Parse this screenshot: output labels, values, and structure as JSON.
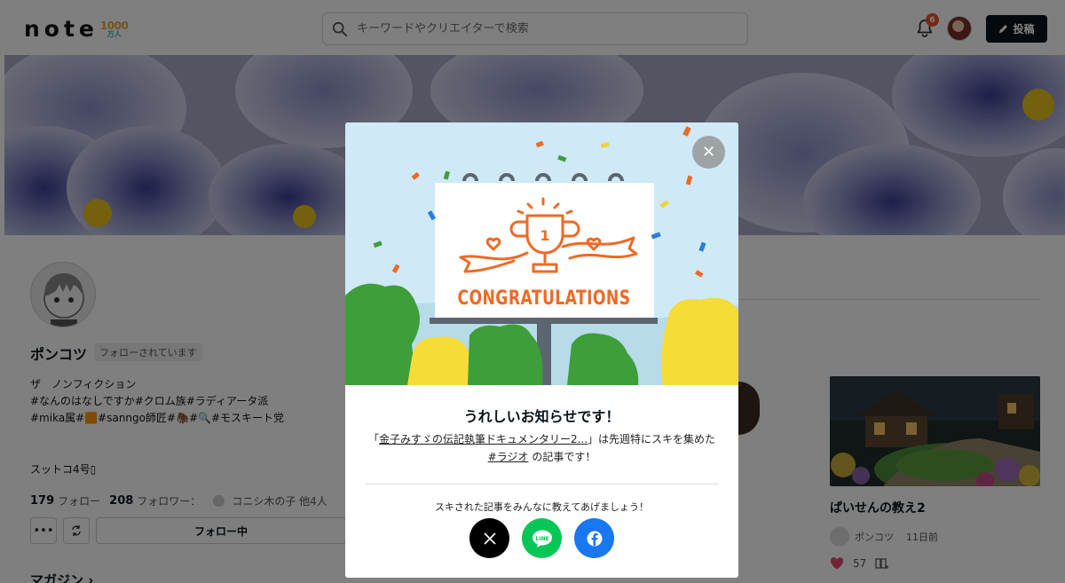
{
  "header": {
    "logo": "note",
    "logo_badge_num": "1000",
    "logo_badge_sub": "万人",
    "search_placeholder": "キーワードやクリエイターで検索",
    "notification_count": "6",
    "post_label": "投稿"
  },
  "profile": {
    "name": "ポンコツ",
    "follow_status": "フォローされています",
    "bio": "ザ　ノンフィクション\n#なんのはなしですか#クロム族#ラディアータ派\n#mika属#🟧#sanngo師匠#🦣#🔍#モスキート党",
    "extra": "スットコ4号▯",
    "following_count": "179",
    "following_label": "フォロー",
    "followers_count": "208",
    "followers_label": "フォロワー：",
    "followers_by": "コニシ木の子 他4人",
    "follow_button": "フォロー中",
    "magazine_label": "マガジン"
  },
  "card": {
    "title": "ぱいせんの教え2",
    "author": "ポンコツ",
    "time": "11日前",
    "likes": "57"
  },
  "modal": {
    "illustration_text": "CONGRATULATIONS",
    "trophy_number": "1",
    "title": "うれしいお知らせです！",
    "msg_open": "「",
    "article_title": "金子みすゞの伝記執筆ドキュメンタリー2...",
    "msg_mid": "」は先週特にスキを集めた",
    "tag": "#ラジオ",
    "msg_end": "の記事です！",
    "share_text": "スキされた記事をみんなに教えてあげましょう！",
    "share_line": "LINE"
  },
  "colors": {
    "accent_dark": "#08131a",
    "x_button": "#000000",
    "line_button": "#06c755",
    "facebook_button": "#1877f2",
    "congrats_orange": "#ee6a24",
    "badge_red": "#e8532d"
  }
}
